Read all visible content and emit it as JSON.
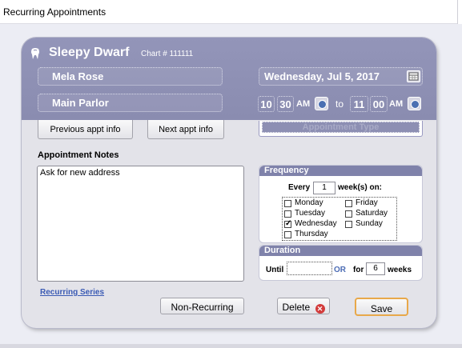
{
  "window": {
    "title": "Recurring Appointments"
  },
  "header": {
    "patient_name": "Sleepy Dwarf",
    "chart_label": "Chart # 111111",
    "provider": "Mela Rose",
    "room": "Main Parlor",
    "date": "Wednesday, Jul 5, 2017",
    "start_hour": "10",
    "start_minute": "30",
    "start_ampm": "AM",
    "to_label": "to",
    "end_hour": "11",
    "end_minute": "00",
    "end_ampm": "AM",
    "prev_label": "Previous appt info",
    "next_label": "Next appt info",
    "appt_type_placeholder": "Appointment Type"
  },
  "notes": {
    "title": "Appointment Notes",
    "text": "Ask for new address"
  },
  "frequency": {
    "title": "Frequency",
    "every_label": "Every",
    "every_value": "1",
    "weeks_on_label": "week(s)  on:",
    "days": [
      {
        "label": "Monday",
        "checked": false
      },
      {
        "label": "Tuesday",
        "checked": false
      },
      {
        "label": "Wednesday",
        "checked": true
      },
      {
        "label": "Thursday",
        "checked": false
      },
      {
        "label": "Friday",
        "checked": false
      },
      {
        "label": "Saturday",
        "checked": false
      },
      {
        "label": "Sunday",
        "checked": false
      }
    ]
  },
  "duration": {
    "title": "Duration",
    "until_label": "Until",
    "until_value": "",
    "or_label": "OR",
    "for_label": "for",
    "for_value": "6",
    "weeks_label": "weeks"
  },
  "footer": {
    "series_link": "Recurring Series",
    "non_recurring_label": "Non-Recurring",
    "delete_label": "Delete",
    "save_label": "Save"
  },
  "colors": {
    "header": "#8a8cb0",
    "panel_title": "#7f82aa",
    "link": "#3a5ab4",
    "save_border": "#e8a84a"
  }
}
